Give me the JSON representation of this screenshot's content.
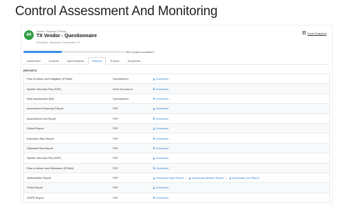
{
  "page_title": "Control Assessment And Monitoring",
  "header": {
    "score": "84",
    "owner": "Owner: Rachael O'Reilly",
    "name": "TX Vendor - Questionnaire",
    "subtitle": "Industrial - Bespoke Framework 1.0",
    "export_label": "Excel Snapshot"
  },
  "progress": {
    "fraction": 0.38,
    "label": "38% project completed"
  },
  "tabs": [
    "Dashboard",
    "Controls",
    "Sys/Initiatives",
    "Reports",
    "Threats",
    "Snapshots"
  ],
  "active_tab_index": 3,
  "reports_label": "REPORTS",
  "reports": [
    {
      "name": "Plan of Action and Mitigation (POAM)",
      "format": "Spreadsheet",
      "actions": [
        "Download"
      ]
    },
    {
      "name": "System Security Plan (SSP)",
      "format": "Word Document",
      "actions": [
        "Download"
      ]
    },
    {
      "name": "Risk Assessment (RA)",
      "format": "Spreadsheet",
      "actions": [
        "Download"
      ]
    },
    {
      "name": "Assessment Summary Report",
      "format": "PDF",
      "actions": [
        "Download"
      ]
    },
    {
      "name": "Assessment List Report",
      "format": "PDF",
      "actions": [
        "Download"
      ]
    },
    {
      "name": "Global Report",
      "format": "PDF",
      "actions": [
        "Download"
      ]
    },
    {
      "name": "Executive Risk Report",
      "format": "PDF",
      "actions": [
        "Download"
      ]
    },
    {
      "name": "Standard Risk Report",
      "format": "PDF",
      "actions": [
        "Download"
      ]
    },
    {
      "name": "System Security Plan (SSP)",
      "format": "PDF",
      "actions": [
        "Download"
      ]
    },
    {
      "name": "Plan of Action and Milestones (POAM)",
      "format": "PDF",
      "actions": [
        "Download"
      ]
    },
    {
      "name": "Optimization Report",
      "format": "PDF",
      "actions": [
        "Download High Report",
        "Download Medium Report",
        "Download Low Report"
      ]
    },
    {
      "name": "Trend Report",
      "format": "PDF",
      "actions": [
        "Download"
      ]
    },
    {
      "name": "GDPR Report",
      "format": "PDF",
      "actions": [
        "Download"
      ]
    }
  ],
  "colors": {
    "accent": "#2d7fd3",
    "progress": "#3a8ee6",
    "badge": "#2e9e44"
  },
  "icons": {
    "download": "download-icon",
    "export": "spreadsheet-icon"
  }
}
